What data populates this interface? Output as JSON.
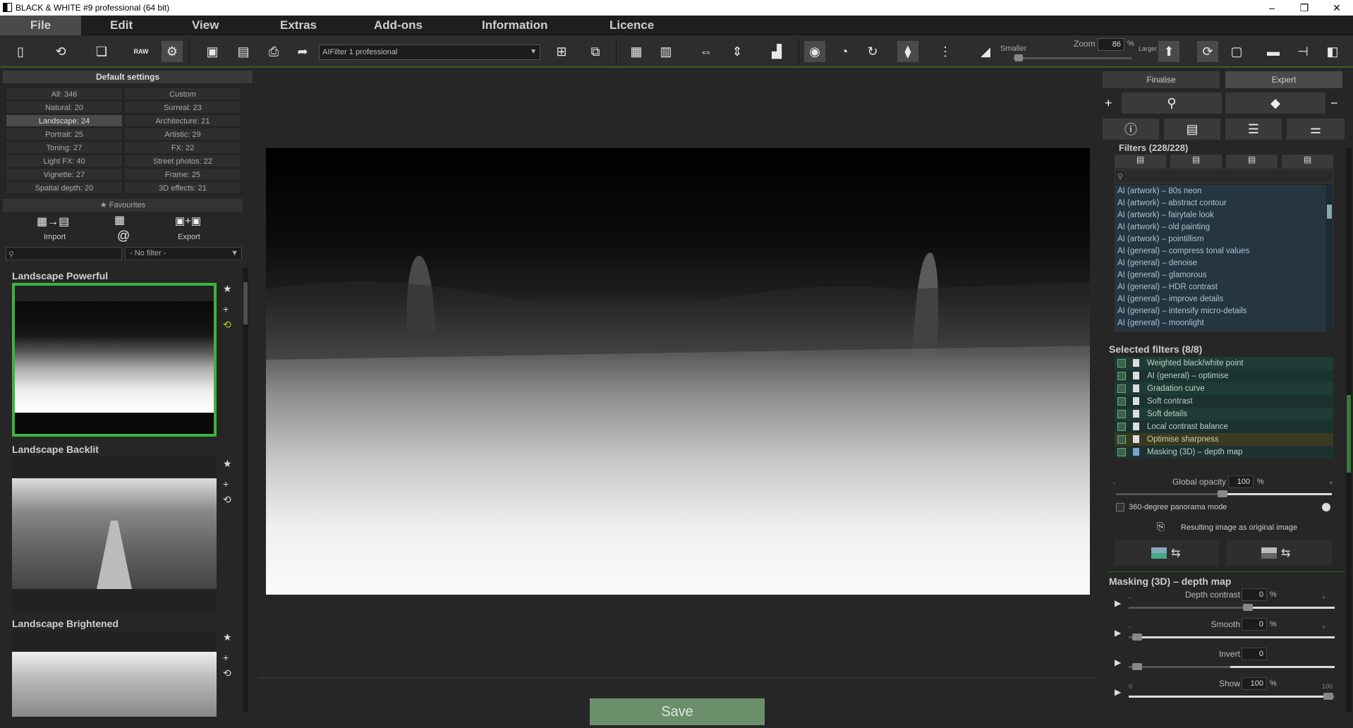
{
  "window": {
    "title": "BLACK & WHITE #9 professional (64 bit)",
    "min": "–",
    "max": "❐",
    "close": "✕"
  },
  "menu": [
    "File",
    "Edit",
    "View",
    "Extras",
    "Add-ons",
    "Information",
    "Licence"
  ],
  "toolbar": {
    "filter_select": "AIFilter 1 professional",
    "zoom_label": "Zoom",
    "zoom_value": "86",
    "zoom_unit": "%",
    "smaller": "Smaller",
    "larger": "Larger"
  },
  "left": {
    "header": "Default settings",
    "categories": [
      [
        "All: 346",
        "Custom"
      ],
      [
        "Natural: 20",
        "Surreal: 23"
      ],
      [
        "Landscape: 24",
        "Architecture: 21"
      ],
      [
        "Portrait: 25",
        "Artistic: 29"
      ],
      [
        "Toning: 27",
        "FX: 22"
      ],
      [
        "Light FX: 40",
        "Street photos: 22"
      ],
      [
        "Vignette: 27",
        "Frame: 25"
      ],
      [
        "Spatial depth: 20",
        "3D effects: 21"
      ]
    ],
    "favourites": "Favourites",
    "import": "Import",
    "at": "@",
    "export": "Export",
    "filter_dropdown": "- No filter -",
    "presets": [
      "Landscape Powerful",
      "Landscape Backlit",
      "Landscape Brightened"
    ]
  },
  "save": "Save",
  "right": {
    "tabs": [
      "Finalise",
      "Expert"
    ],
    "filters_title": "Filters (228/228)",
    "filters": [
      "AI (artwork) – 80s neon",
      "AI (artwork) – abstract contour",
      "AI (artwork) – fairytale look",
      "AI (artwork) – old painting",
      "AI (artwork) – pointillism",
      "AI (general) – compress tonal values",
      "AI (general) – denoise",
      "AI (general) – glamorous",
      "AI (general) – HDR contrast",
      "AI (general) – improve details",
      "AI (general) – intensify micro-details",
      "AI (general) – moonlight"
    ],
    "selected_title": "Selected filters (8/8)",
    "selected": [
      "Weighted black/white point",
      "AI (general) – optimise",
      "Gradation curve",
      "Soft contrast",
      "Soft details",
      "Local contrast balance",
      "Optimise sharpness",
      "Masking (3D) – depth map"
    ],
    "global_opacity_label": "Global opacity",
    "global_opacity": "100",
    "pct": "%",
    "panorama": "360-degree panorama mode",
    "resulting": "Resulting image as original image",
    "mask_title": "Masking (3D) – depth map",
    "params": [
      {
        "label": "Depth contrast",
        "value": "0",
        "unit": "%",
        "min": "-",
        "max": "+"
      },
      {
        "label": "Smooth",
        "value": "0",
        "unit": "%",
        "min": "-",
        "max": "+"
      },
      {
        "label": "Invert",
        "value": "0",
        "unit": "",
        "min": "",
        "max": ""
      },
      {
        "label": "Show",
        "value": "100",
        "unit": "%",
        "min": "0",
        "max": "100"
      }
    ]
  }
}
